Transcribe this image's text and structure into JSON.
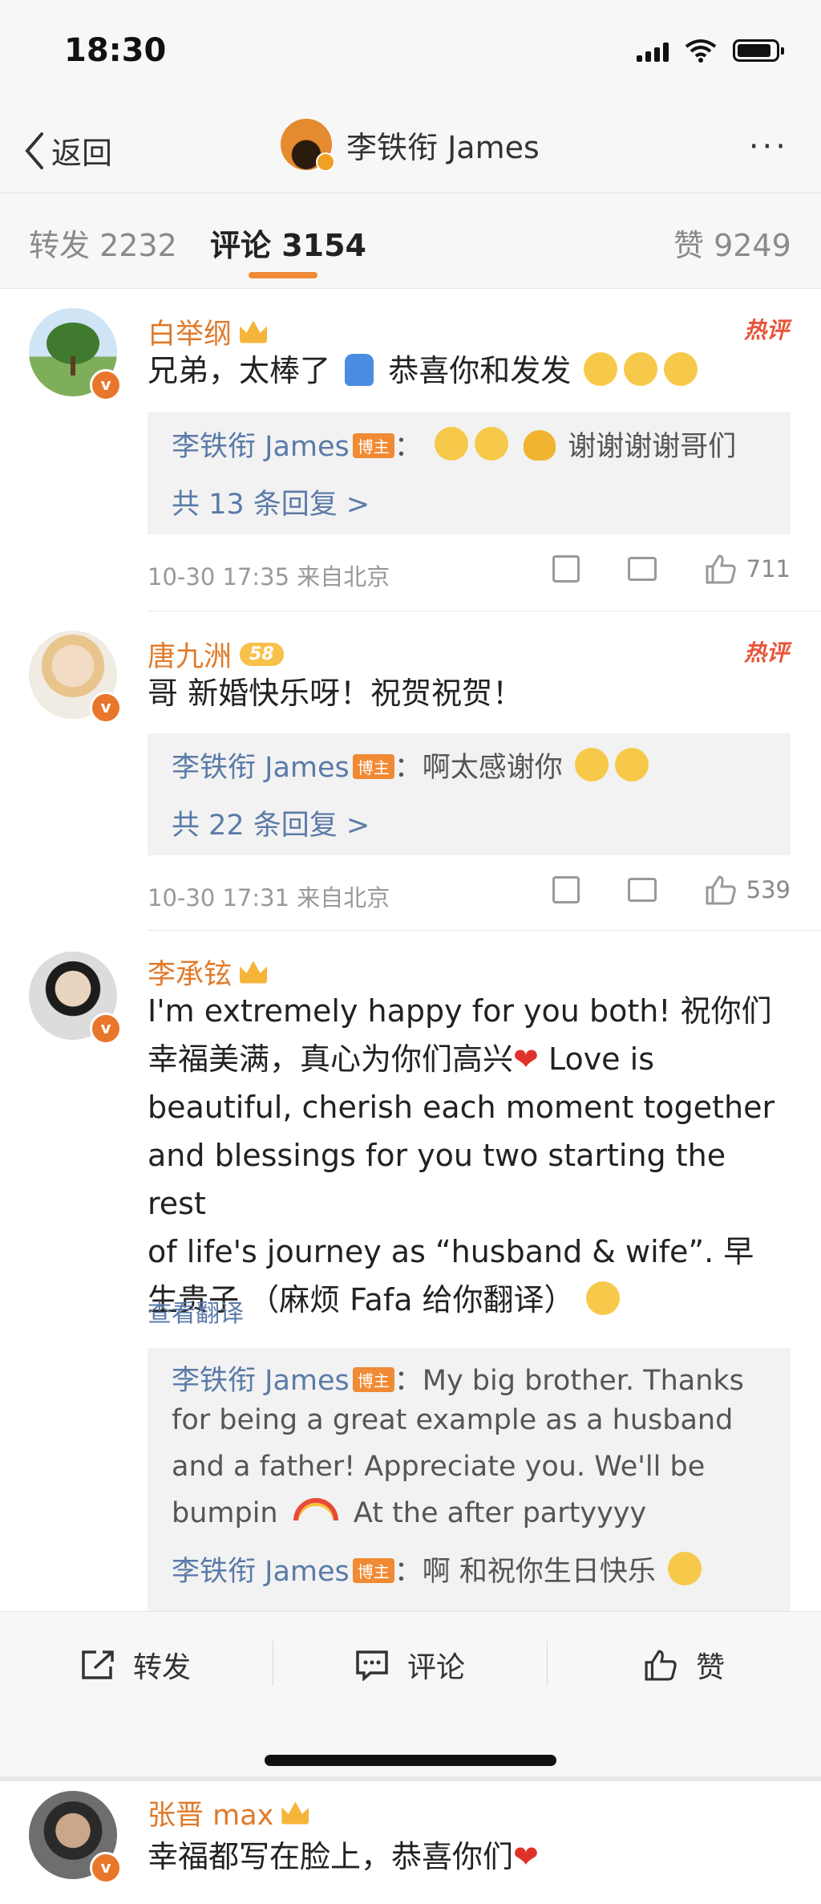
{
  "status": {
    "time": "18:30"
  },
  "nav": {
    "back_label": "返回",
    "title": "李铁衔 James",
    "more": "···"
  },
  "tabs": {
    "repost": "转发 2232",
    "comments": "评论 3154",
    "likes": "赞 9249"
  },
  "comments": [
    {
      "user": "白举纲",
      "hot": "热评",
      "text_a": "兄弟，太棒了",
      "text_b": "恭喜你和发发",
      "reply_name": "李铁衔 James",
      "host_tag": "博主",
      "reply_text": "：",
      "reply_text_b": "谢谢谢谢哥们",
      "more_replies": "共 13 条回复 >",
      "time": "10-30 17:35 来自北京",
      "likes": "711"
    },
    {
      "user": "唐九洲",
      "level": "58",
      "hot": "热评",
      "text": "哥 新婚快乐呀！祝贺祝贺！",
      "reply_name": "李铁衔 James",
      "host_tag": "博主",
      "reply_text": "：啊太感谢你",
      "more_replies": "共 22 条回复 >",
      "time": "10-30 17:31 来自北京",
      "likes": "539"
    },
    {
      "user": "李承铉",
      "line1": "I'm extremely happy for you both!  祝你们",
      "line2a": "幸福美满，真心为你们高兴",
      "line2b": " Love is",
      "line3": "beautiful, cherish each moment together",
      "line4": "and blessings for you two starting the rest",
      "line5": "of life's journey as “husband & wife”.  早",
      "line6": "生贵子  （麻烦 Fafa 给你翻译）",
      "translate": "查看翻译",
      "reply1_name": "李铁衔 James",
      "reply1_l1": "：My big brother. Thanks",
      "reply1_l2": "for being a great example as a husband",
      "reply1_l3": "and a father! Appreciate you. We'll be",
      "reply1_l4a": "bumpin",
      "reply1_l4b": "At the after partyyyy",
      "reply2_name": "李铁衔 James",
      "reply2_text": "：啊 和祝你生日快乐",
      "host_tag": "博主"
    },
    {
      "user": "张晋 max",
      "text": "幸福都写在脸上，恭喜你们"
    }
  ],
  "bottom_bar": {
    "repost": "转发",
    "comment": "评论",
    "like": "赞"
  },
  "colors": {
    "accent": "#f08a34",
    "link": "#5b7ba8",
    "username": "#e07a2a",
    "hot": "#e8543a"
  }
}
